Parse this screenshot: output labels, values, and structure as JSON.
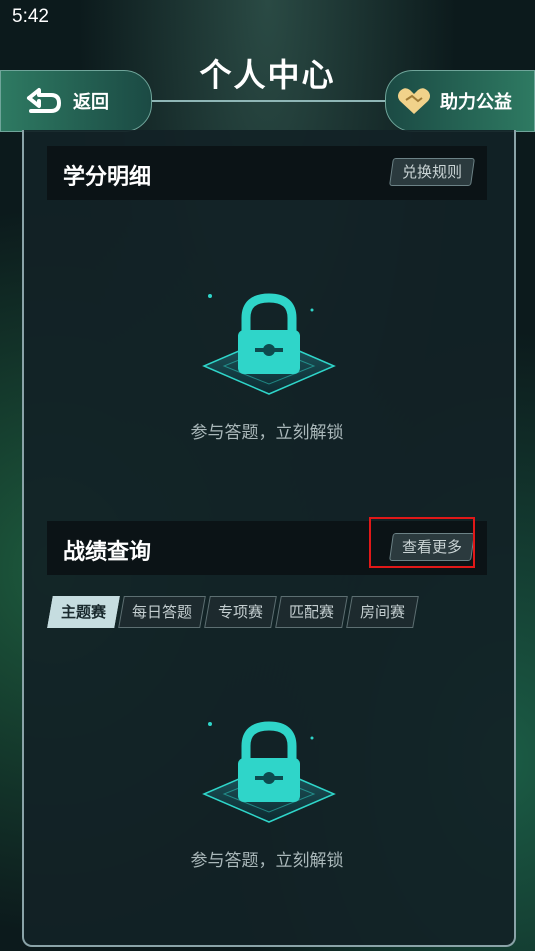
{
  "status": {
    "time": "5:42"
  },
  "header": {
    "title": "个人中心",
    "back_label": "返回",
    "charity_label": "助力公益"
  },
  "credits": {
    "title": "学分明细",
    "rules_button": "兑换规则",
    "empty_text": "参与答题，立刻解锁"
  },
  "records": {
    "title": "战绩查询",
    "more_button": "查看更多",
    "tabs": [
      {
        "label": "主题赛",
        "active": true
      },
      {
        "label": "每日答题",
        "active": false
      },
      {
        "label": "专项赛",
        "active": false
      },
      {
        "label": "匹配赛",
        "active": false
      },
      {
        "label": "房间赛",
        "active": false
      }
    ],
    "empty_text": "参与答题，立刻解锁"
  },
  "colors": {
    "accent": "#2fd5c9",
    "highlight": "#e01818"
  }
}
